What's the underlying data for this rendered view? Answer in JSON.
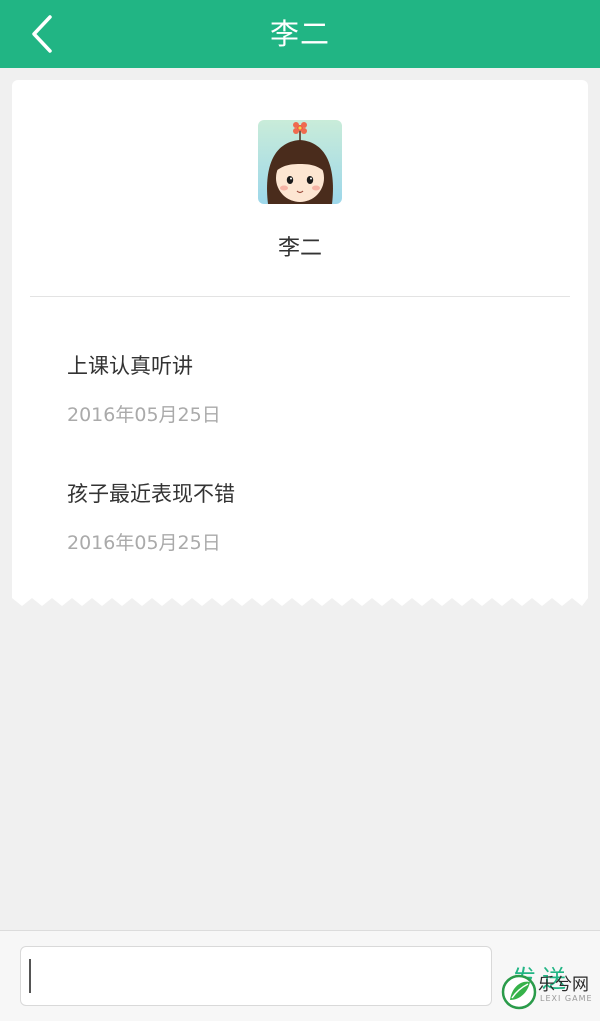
{
  "header": {
    "title": "李二",
    "back_icon": "back-arrow-icon"
  },
  "profile": {
    "name": "李二",
    "avatar_icon": "girl-avatar-icon"
  },
  "comments": [
    {
      "text": "上课认真听讲",
      "date": "2016年05月25日"
    },
    {
      "text": "孩子最近表现不错",
      "date": "2016年05月25日"
    }
  ],
  "composer": {
    "input_value": "",
    "send_label": "发送"
  },
  "watermark": {
    "text": "乐兮网",
    "sub": "LEXI GAME"
  },
  "colors": {
    "accent": "#21b584",
    "background": "#f0f0f0",
    "card": "#ffffff"
  }
}
